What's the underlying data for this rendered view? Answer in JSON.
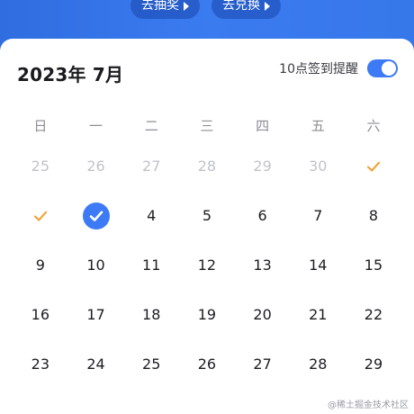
{
  "top": {
    "lottery_label": "去抽奖",
    "exchange_label": "去兑换"
  },
  "calendar": {
    "month_title": "2023年 7月",
    "reminder_label": "10点签到提醒",
    "reminder_enabled": true,
    "weekdays": [
      "日",
      "一",
      "二",
      "三",
      "四",
      "五",
      "六"
    ],
    "weeks": [
      [
        {
          "text": "25",
          "muted": true
        },
        {
          "text": "26",
          "muted": true
        },
        {
          "text": "27",
          "muted": true
        },
        {
          "text": "28",
          "muted": true
        },
        {
          "text": "29",
          "muted": true
        },
        {
          "text": "30",
          "muted": true
        },
        {
          "text": "",
          "mark": "check-orange"
        }
      ],
      [
        {
          "text": "",
          "mark": "check-orange"
        },
        {
          "text": "",
          "mark": "check-selected"
        },
        {
          "text": "4"
        },
        {
          "text": "5"
        },
        {
          "text": "6"
        },
        {
          "text": "7"
        },
        {
          "text": "8"
        }
      ],
      [
        {
          "text": "9"
        },
        {
          "text": "10"
        },
        {
          "text": "11"
        },
        {
          "text": "12"
        },
        {
          "text": "13"
        },
        {
          "text": "14"
        },
        {
          "text": "15"
        }
      ],
      [
        {
          "text": "16"
        },
        {
          "text": "17"
        },
        {
          "text": "18"
        },
        {
          "text": "19"
        },
        {
          "text": "20"
        },
        {
          "text": "21"
        },
        {
          "text": "22"
        }
      ],
      [
        {
          "text": "23"
        },
        {
          "text": "24"
        },
        {
          "text": "25"
        },
        {
          "text": "26"
        },
        {
          "text": "27"
        },
        {
          "text": "28"
        },
        {
          "text": "29"
        }
      ]
    ]
  },
  "colors": {
    "accent": "#3d7af5",
    "check_orange": "#f0a33a",
    "muted": "#c2c3c9"
  },
  "watermark": "@稀土掘金技术社区"
}
